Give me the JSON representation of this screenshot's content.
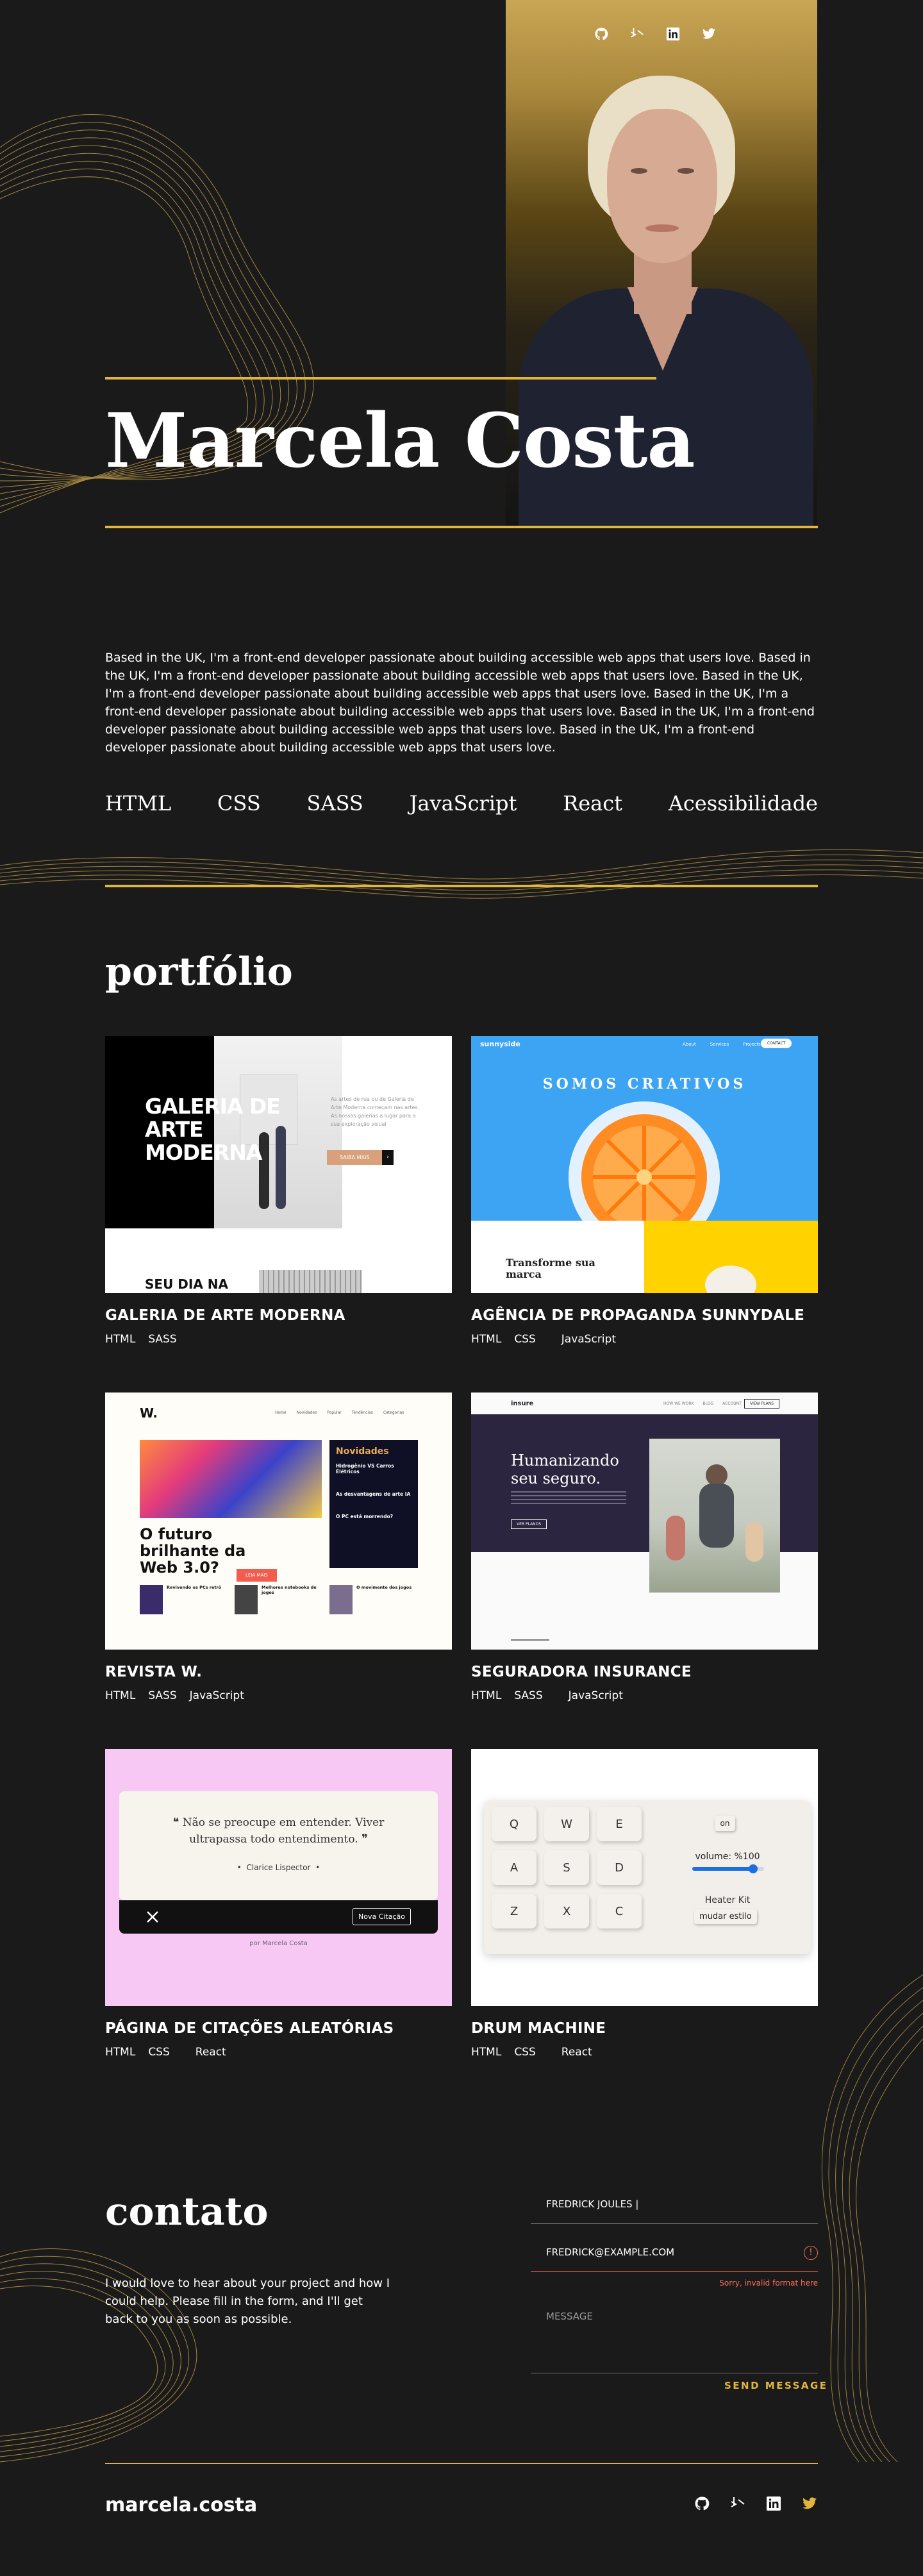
{
  "hero": {
    "name": "Marcela Costa",
    "social": [
      "github-icon",
      "frontend-mentor-icon",
      "linkedin-icon",
      "twitter-icon"
    ]
  },
  "intro": "Based in the UK, I'm a front-end developer passionate about building accessible web apps that users love. Based in the UK, I'm a front-end developer passionate about building accessible web apps that users love. Based in the UK, I'm a front-end developer passionate about building accessible web apps that users love. Based in the UK, I'm a front-end developer passionate about building accessible web apps that users love.  Based in the UK, I'm a front-end developer passionate about building accessible web apps that users love.  Based in the UK, I'm a front-end developer passionate about building accessible web apps that users love.",
  "skills": [
    "HTML",
    "CSS",
    "SASS",
    "JavaScript",
    "React",
    "Acessibilidade"
  ],
  "portfolio": {
    "title": "portfólio",
    "projects": [
      {
        "title": "GALERIA DE ARTE MODERNA",
        "tags": [
          "HTML",
          "SASS"
        ],
        "thumb": {
          "heading_1": "GALERIA DE",
          "heading_2": "ARTE",
          "heading_3": "MODERNA",
          "body": "As artes de rua ou de Galeria de Arte Moderna começam nas artes. As nossas galerias a lugar para a sua exploração visual",
          "button": "SAIBA MAIS",
          "sub": "SEU DIA NA"
        }
      },
      {
        "title": "AGÊNCIA DE PROPAGANDA  SUNNYDALE",
        "tags": [
          "HTML",
          "CSS",
          "JavaScript"
        ],
        "thumb": {
          "logo": "sunnyside",
          "nav": [
            "About",
            "Services",
            "Projects"
          ],
          "contact": "CONTACT",
          "headline": "SOMOS CRIATIVOS",
          "sub_1": "Transforme sua",
          "sub_2": "marca"
        }
      },
      {
        "title": "REVISTA W.",
        "tags": [
          "HTML",
          "SASS",
          "JavaScript"
        ],
        "thumb": {
          "logo": "W.",
          "nav": [
            "Home",
            "Novidades",
            "Popular",
            "Tendências",
            "Categorias"
          ],
          "headline_1": "O futuro",
          "headline_2": "brilhante da",
          "headline_3": "Web 3.0?",
          "button": "LEIA MAIS",
          "side_title": "Novidades",
          "side_items": [
            "Hidrogênio VS Carros Elétricos",
            "As desvantagens de arte IA",
            "O PC está morrendo?"
          ],
          "bottom_items": [
            "Revivendo os PCs retrô",
            "Melhores notebooks de jogos",
            "O movimento dos jogos"
          ]
        }
      },
      {
        "title": "SEGURADORA INSURANCE",
        "tags": [
          "HTML",
          "SASS",
          "JavaScript"
        ],
        "thumb": {
          "logo": "insure",
          "nav": [
            "HOW WE WORK",
            "BLOG",
            "ACCOUNT"
          ],
          "nav_button": "VIEW PLANS",
          "headline_1": "Humanizando",
          "headline_2": "seu seguro.",
          "button": "VER PLANOS"
        }
      },
      {
        "title": "PÁGINA DE CITAÇÕES ALEATÓRIAS",
        "tags": [
          "HTML",
          "CSS",
          "React"
        ],
        "thumb": {
          "quote_open": "❝",
          "quote": "Não se preocupe em entender. Viver ultrapassa todo entendimento.",
          "quote_close": "❞",
          "author": "Clarice Lispector",
          "button": "Nova Citação",
          "credit": "por Marcela Costa"
        }
      },
      {
        "title": "DRUM MACHINE",
        "tags": [
          "HTML",
          "CSS",
          "React"
        ],
        "thumb": {
          "pads": [
            "Q",
            "W",
            "E",
            "A",
            "S",
            "D",
            "Z",
            "X",
            "C"
          ],
          "power": "on",
          "volume": "volume: %100",
          "volume_level": 0.85,
          "kit": "Heater Kit",
          "switch": "mudar estilo"
        }
      }
    ]
  },
  "contact": {
    "title": "contato",
    "text": "I would love to hear about your project and how I could help. Please fill in the form, and I'll get back to you as soon as possible.",
    "name_value": "FREDRICK JOULES |",
    "email_value": "FREDRICK@EXAMPLE.COM",
    "message_placeholder": "MESSAGE",
    "error": "Sorry, invalid format here",
    "error_icon": "!",
    "send": "SEND MESSAGE"
  },
  "footer": {
    "brand": "marcela.costa",
    "social": [
      "github-icon",
      "frontend-mentor-icon",
      "linkedin-icon",
      "twitter-icon"
    ]
  },
  "colors": {
    "accent": "#e2b53d",
    "background": "#1a1a1a",
    "error": "#ff6f5b"
  }
}
